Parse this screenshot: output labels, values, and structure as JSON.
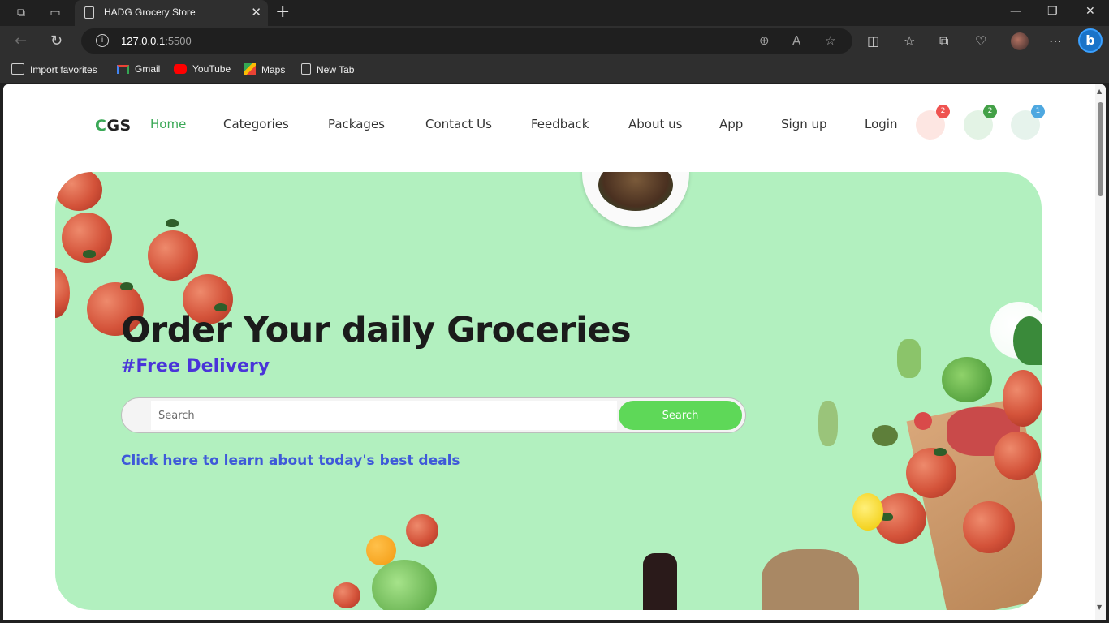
{
  "browser": {
    "tab_title": "HADG Grocery Store",
    "url_host": "127.0.0.1",
    "url_port": ":5500",
    "favorites": [
      {
        "label": "Import favorites",
        "icon": "import-icon"
      },
      {
        "label": "Gmail",
        "icon": "gmail-icon"
      },
      {
        "label": "YouTube",
        "icon": "youtube-icon"
      },
      {
        "label": "Maps",
        "icon": "maps-icon"
      },
      {
        "label": "New Tab",
        "icon": "page-icon"
      }
    ],
    "bing_label": "b"
  },
  "site": {
    "logo_c": "C",
    "logo_rest": "GS",
    "nav": [
      "Home",
      "Categories",
      "Packages",
      "Contact Us",
      "Feedback",
      "About us",
      "App",
      "Sign up",
      "Login"
    ],
    "badges": [
      {
        "count": "2",
        "color": "#ef5350",
        "bubble": "#fde6e2"
      },
      {
        "count": "2",
        "color": "#43a047",
        "bubble": "#e3f3e5"
      },
      {
        "count": "1",
        "color": "#4ea8e0",
        "bubble": "#e6f3ec"
      }
    ]
  },
  "hero": {
    "headline": "Order Your daily Groceries",
    "subhead": "#Free Delivery",
    "search_placeholder": "Search",
    "search_button": "Search",
    "deals_link": "Click here to learn about today's best deals"
  },
  "colors": {
    "hero_bg": "#b2f0bf",
    "accent_green": "#3aa856",
    "button_green": "#5ed858",
    "subhead_purple": "#4a34d9",
    "link_blue": "#3f59d9"
  }
}
